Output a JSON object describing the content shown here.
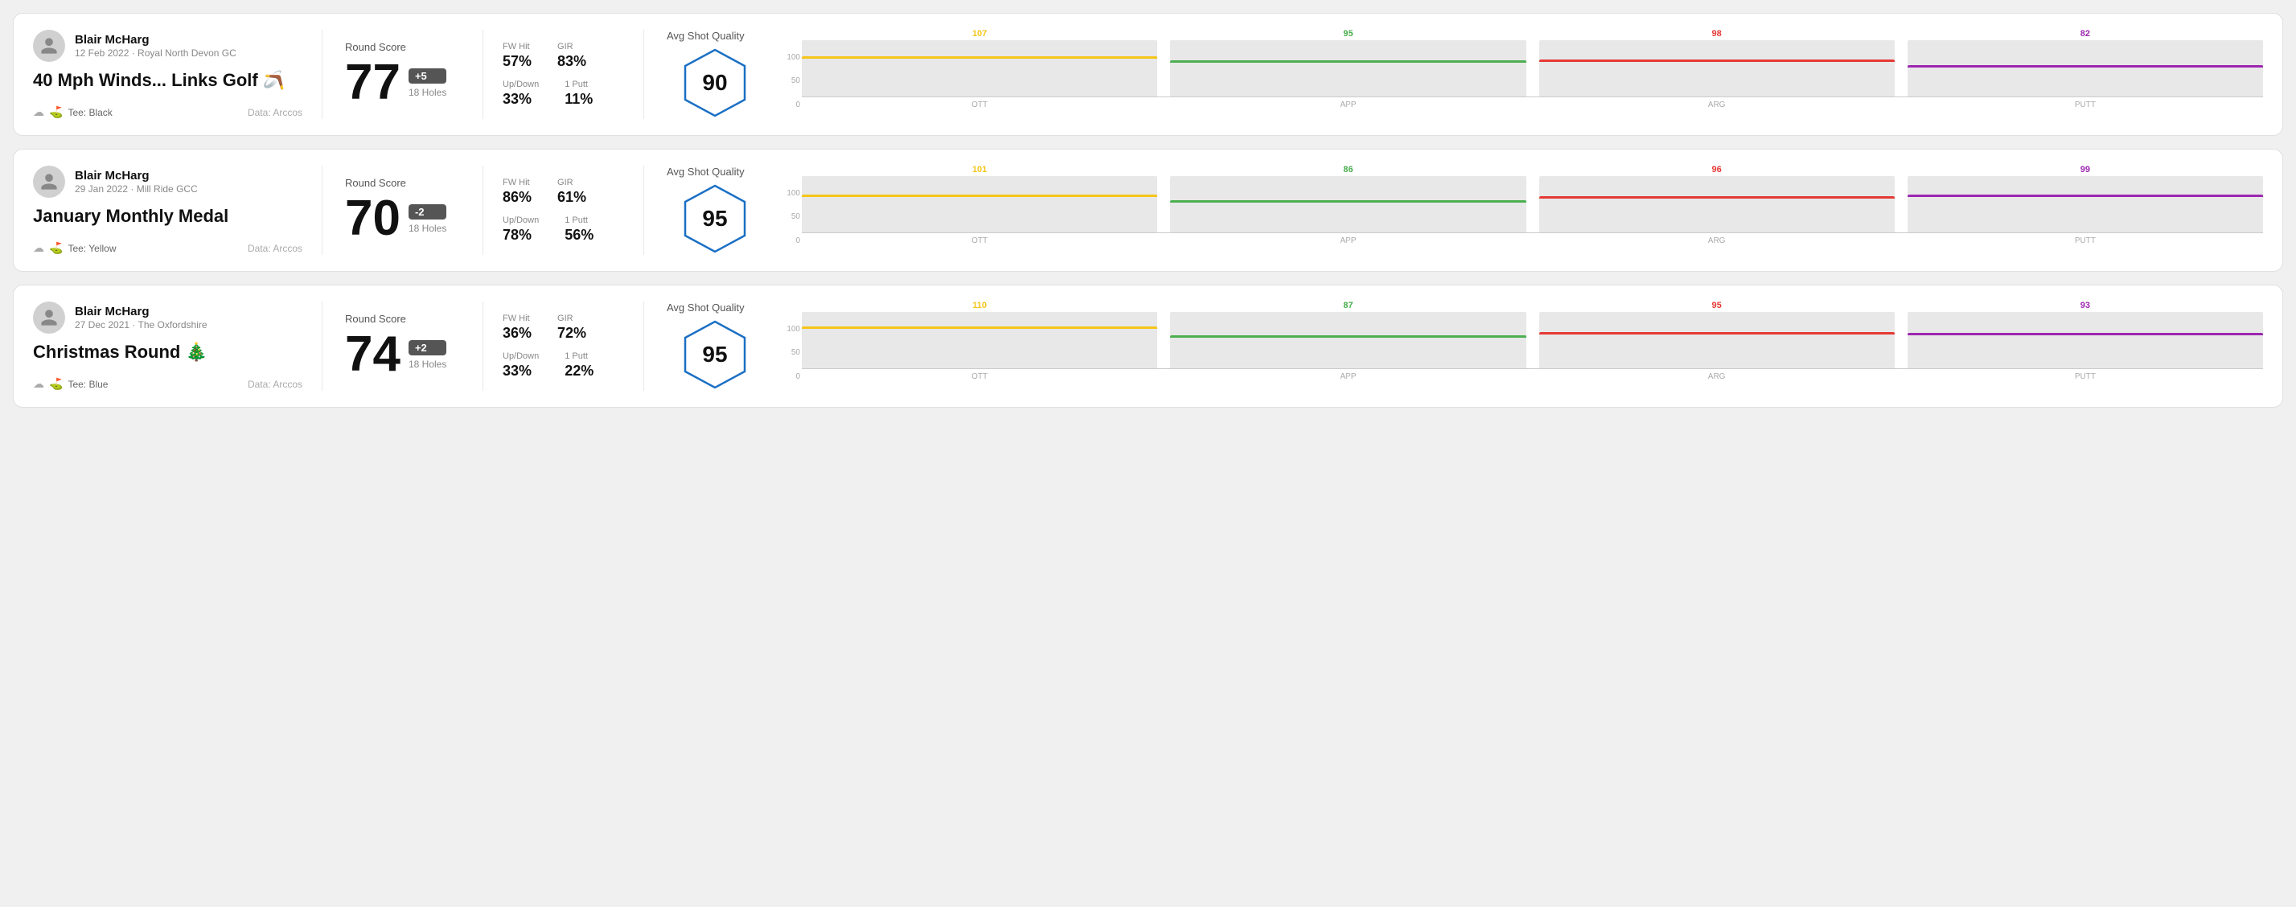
{
  "rounds": [
    {
      "id": "round-1",
      "user": {
        "name": "Blair McHarg",
        "meta": "12 Feb 2022 · Royal North Devon GC"
      },
      "title": "40 Mph Winds... Links Golf 🪃",
      "tee": "Black",
      "data_source": "Data: Arccos",
      "score": {
        "label": "Round Score",
        "value": "77",
        "badge": "+5",
        "badge_type": "over",
        "holes": "18 Holes"
      },
      "stats": {
        "fw_hit_label": "FW Hit",
        "fw_hit_value": "57%",
        "gir_label": "GIR",
        "gir_value": "83%",
        "updown_label": "Up/Down",
        "updown_value": "33%",
        "one_putt_label": "1 Putt",
        "one_putt_value": "11%"
      },
      "quality": {
        "label": "Avg Shot Quality",
        "score": "90",
        "chart": {
          "bars": [
            {
              "label": "OTT",
              "value": 107,
              "color": "#f5c518",
              "height_pct": 71
            },
            {
              "label": "APP",
              "value": 95,
              "color": "#4caf50",
              "height_pct": 63
            },
            {
              "label": "ARG",
              "value": 98,
              "color": "#e53935",
              "height_pct": 65
            },
            {
              "label": "PUTT",
              "value": 82,
              "color": "#9c27b0",
              "height_pct": 55
            }
          ],
          "y_labels": [
            "100",
            "50",
            "0"
          ]
        }
      }
    },
    {
      "id": "round-2",
      "user": {
        "name": "Blair McHarg",
        "meta": "29 Jan 2022 · Mill Ride GCC"
      },
      "title": "January Monthly Medal",
      "tee": "Yellow",
      "data_source": "Data: Arccos",
      "score": {
        "label": "Round Score",
        "value": "70",
        "badge": "-2",
        "badge_type": "under",
        "holes": "18 Holes"
      },
      "stats": {
        "fw_hit_label": "FW Hit",
        "fw_hit_value": "86%",
        "gir_label": "GIR",
        "gir_value": "61%",
        "updown_label": "Up/Down",
        "updown_value": "78%",
        "one_putt_label": "1 Putt",
        "one_putt_value": "56%"
      },
      "quality": {
        "label": "Avg Shot Quality",
        "score": "95",
        "chart": {
          "bars": [
            {
              "label": "OTT",
              "value": 101,
              "color": "#f5c518",
              "height_pct": 67
            },
            {
              "label": "APP",
              "value": 86,
              "color": "#4caf50",
              "height_pct": 57
            },
            {
              "label": "ARG",
              "value": 96,
              "color": "#e53935",
              "height_pct": 64
            },
            {
              "label": "PUTT",
              "value": 99,
              "color": "#9c27b0",
              "height_pct": 66
            }
          ],
          "y_labels": [
            "100",
            "50",
            "0"
          ]
        }
      }
    },
    {
      "id": "round-3",
      "user": {
        "name": "Blair McHarg",
        "meta": "27 Dec 2021 · The Oxfordshire"
      },
      "title": "Christmas Round 🎄",
      "tee": "Blue",
      "data_source": "Data: Arccos",
      "score": {
        "label": "Round Score",
        "value": "74",
        "badge": "+2",
        "badge_type": "over",
        "holes": "18 Holes"
      },
      "stats": {
        "fw_hit_label": "FW Hit",
        "fw_hit_value": "36%",
        "gir_label": "GIR",
        "gir_value": "72%",
        "updown_label": "Up/Down",
        "updown_value": "33%",
        "one_putt_label": "1 Putt",
        "one_putt_value": "22%"
      },
      "quality": {
        "label": "Avg Shot Quality",
        "score": "95",
        "chart": {
          "bars": [
            {
              "label": "OTT",
              "value": 110,
              "color": "#f5c518",
              "height_pct": 73
            },
            {
              "label": "APP",
              "value": 87,
              "color": "#4caf50",
              "height_pct": 58
            },
            {
              "label": "ARG",
              "value": 95,
              "color": "#e53935",
              "height_pct": 63
            },
            {
              "label": "PUTT",
              "value": 93,
              "color": "#9c27b0",
              "height_pct": 62
            }
          ],
          "y_labels": [
            "100",
            "50",
            "0"
          ]
        }
      }
    }
  ]
}
